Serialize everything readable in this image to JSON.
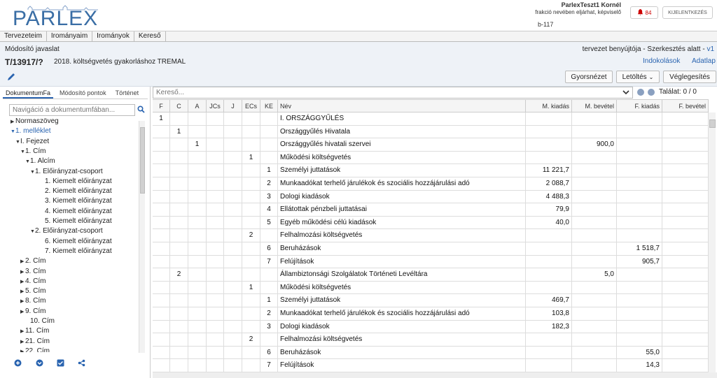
{
  "header": {
    "logo_text": "PARLEX",
    "user_name": "ParlexTeszt1 Kornél",
    "user_role": "frakció nevében eljárhat, képviselő",
    "user_code": "b-117",
    "notifications_count": "84",
    "logout_label": "KIJELENTKEZÉS"
  },
  "menu": [
    "Tervezeteim",
    "Irományaim",
    "Irományok",
    "Kereső"
  ],
  "document": {
    "type": "Módosító javaslat",
    "status": "tervezet benyújtója - Szerkesztés alatt -",
    "version": "v1",
    "id": "T/13917/?",
    "title": "2018. költségvetés gyakorláshoz TREMAL",
    "link_indoklasok": "Indokolások",
    "link_adatlap": "Adatlap"
  },
  "toolbar": {
    "preview": "Gyorsnézet",
    "download": "Letöltés",
    "finalize": "Véglegesítés"
  },
  "left_panel": {
    "tabs": [
      "DokumentumFa",
      "Módosító pontok",
      "Történet"
    ],
    "nav_placeholder": "Navigáció a dokumentumfában...",
    "tree": [
      {
        "label": "Normaszöveg",
        "arrow": "▶",
        "indent": 0,
        "blue": false
      },
      {
        "label": "1. melléklet",
        "arrow": "▼",
        "indent": 0,
        "blue": true
      },
      {
        "label": "I. Fejezet",
        "arrow": "▼",
        "indent": 1,
        "blue": false
      },
      {
        "label": "1. Cím",
        "arrow": "▼",
        "indent": 2,
        "blue": false
      },
      {
        "label": "1. Alcím",
        "arrow": "▼",
        "indent": 3,
        "blue": false
      },
      {
        "label": "1. Előirányzat-csoport",
        "arrow": "▼",
        "indent": 4,
        "blue": false
      },
      {
        "label": "1. Kiemelt előirányzat",
        "arrow": "",
        "indent": 6,
        "blue": false
      },
      {
        "label": "2. Kiemelt előirányzat",
        "arrow": "",
        "indent": 6,
        "blue": false
      },
      {
        "label": "3. Kiemelt előirányzat",
        "arrow": "",
        "indent": 6,
        "blue": false
      },
      {
        "label": "4. Kiemelt előirányzat",
        "arrow": "",
        "indent": 6,
        "blue": false
      },
      {
        "label": "5. Kiemelt előirányzat",
        "arrow": "",
        "indent": 6,
        "blue": false
      },
      {
        "label": "2. Előirányzat-csoport",
        "arrow": "▼",
        "indent": 4,
        "blue": false
      },
      {
        "label": "6. Kiemelt előirányzat",
        "arrow": "",
        "indent": 6,
        "blue": false
      },
      {
        "label": "7. Kiemelt előirányzat",
        "arrow": "",
        "indent": 6,
        "blue": false
      },
      {
        "label": "2. Cím",
        "arrow": "▶",
        "indent": 2,
        "blue": false
      },
      {
        "label": "3. Cím",
        "arrow": "▶",
        "indent": 2,
        "blue": false
      },
      {
        "label": "4. Cím",
        "arrow": "▶",
        "indent": 2,
        "blue": false
      },
      {
        "label": "5. Cím",
        "arrow": "▶",
        "indent": 2,
        "blue": false
      },
      {
        "label": "8. Cím",
        "arrow": "▶",
        "indent": 2,
        "blue": false
      },
      {
        "label": "9. Cím",
        "arrow": "▶",
        "indent": 2,
        "blue": false
      },
      {
        "label": "10. Cím",
        "arrow": "",
        "indent": 3,
        "blue": false
      },
      {
        "label": "11. Cím",
        "arrow": "▶",
        "indent": 2,
        "blue": false
      },
      {
        "label": "21. Cím",
        "arrow": "▶",
        "indent": 2,
        "blue": false
      },
      {
        "label": "22. Cím",
        "arrow": "▶",
        "indent": 2,
        "blue": false
      }
    ]
  },
  "search": {
    "placeholder": "Kereső...",
    "hits": "Találat: 0 / 0"
  },
  "table": {
    "headers": [
      "F",
      "C",
      "A",
      "JCs",
      "J",
      "ECs",
      "KE",
      "Név",
      "M. kiadás",
      "M. bevétel",
      "F. kiadás",
      "F. bevétel"
    ],
    "rows": [
      [
        "1",
        "",
        "",
        "",
        "",
        "",
        "",
        "I. ORSZÁGGYŰLÉS",
        "",
        "",
        "",
        ""
      ],
      [
        "",
        "1",
        "",
        "",
        "",
        "",
        "",
        "Országgyűlés Hivatala",
        "",
        "",
        "",
        ""
      ],
      [
        "",
        "",
        "1",
        "",
        "",
        "",
        "",
        "Országgyűlés hivatali szervei",
        "",
        "900,0",
        "",
        ""
      ],
      [
        "",
        "",
        "",
        "",
        "",
        "1",
        "",
        "Működési költségvetés",
        "",
        "",
        "",
        ""
      ],
      [
        "",
        "",
        "",
        "",
        "",
        "",
        "1",
        "Személyi juttatások",
        "11 221,7",
        "",
        "",
        ""
      ],
      [
        "",
        "",
        "",
        "",
        "",
        "",
        "2",
        "Munkaadókat terhelő járulékok és szociális hozzájárulási adó",
        "2 088,7",
        "",
        "",
        ""
      ],
      [
        "",
        "",
        "",
        "",
        "",
        "",
        "3",
        "Dologi kiadások",
        "4 488,3",
        "",
        "",
        ""
      ],
      [
        "",
        "",
        "",
        "",
        "",
        "",
        "4",
        "Ellátottak pénzbeli juttatásai",
        "79,9",
        "",
        "",
        ""
      ],
      [
        "",
        "",
        "",
        "",
        "",
        "",
        "5",
        "Egyéb működési célú kiadások",
        "40,0",
        "",
        "",
        ""
      ],
      [
        "",
        "",
        "",
        "",
        "",
        "2",
        "",
        "Felhalmozási költségvetés",
        "",
        "",
        "",
        ""
      ],
      [
        "",
        "",
        "",
        "",
        "",
        "",
        "6",
        "Beruházások",
        "",
        "",
        "1 518,7",
        ""
      ],
      [
        "",
        "",
        "",
        "",
        "",
        "",
        "7",
        "Felújítások",
        "",
        "",
        "905,7",
        ""
      ],
      [
        "",
        "2",
        "",
        "",
        "",
        "",
        "",
        "Állambiztonsági Szolgálatok Történeti Levéltára",
        "",
        "5,0",
        "",
        ""
      ],
      [
        "",
        "",
        "",
        "",
        "",
        "1",
        "",
        "Működési költségvetés",
        "",
        "",
        "",
        ""
      ],
      [
        "",
        "",
        "",
        "",
        "",
        "",
        "1",
        "Személyi juttatások",
        "469,7",
        "",
        "",
        ""
      ],
      [
        "",
        "",
        "",
        "",
        "",
        "",
        "2",
        "Munkaadókat terhelő járulékok és szociális hozzájárulási adó",
        "103,8",
        "",
        "",
        ""
      ],
      [
        "",
        "",
        "",
        "",
        "",
        "",
        "3",
        "Dologi kiadások",
        "182,3",
        "",
        "",
        ""
      ],
      [
        "",
        "",
        "",
        "",
        "",
        "2",
        "",
        "Felhalmozási költségvetés",
        "",
        "",
        "",
        ""
      ],
      [
        "",
        "",
        "",
        "",
        "",
        "",
        "6",
        "Beruházások",
        "",
        "",
        "55,0",
        ""
      ],
      [
        "",
        "",
        "",
        "",
        "",
        "",
        "7",
        "Felújítások",
        "",
        "",
        "14,3",
        ""
      ]
    ]
  },
  "colors": {
    "accent": "#2a64b0",
    "header_bg": "#eef2f7",
    "bell": "#cc0000"
  },
  "icons": {
    "logo": "parlament-silhouette-icon",
    "bell": "bell-icon",
    "pencil": "pencil-icon",
    "search": "search-icon",
    "dropdown": "chevron-down-icon",
    "add": "plus-circle-icon",
    "collapse": "chevron-circle-icon",
    "check": "checkbox-icon",
    "share": "share-icon"
  }
}
